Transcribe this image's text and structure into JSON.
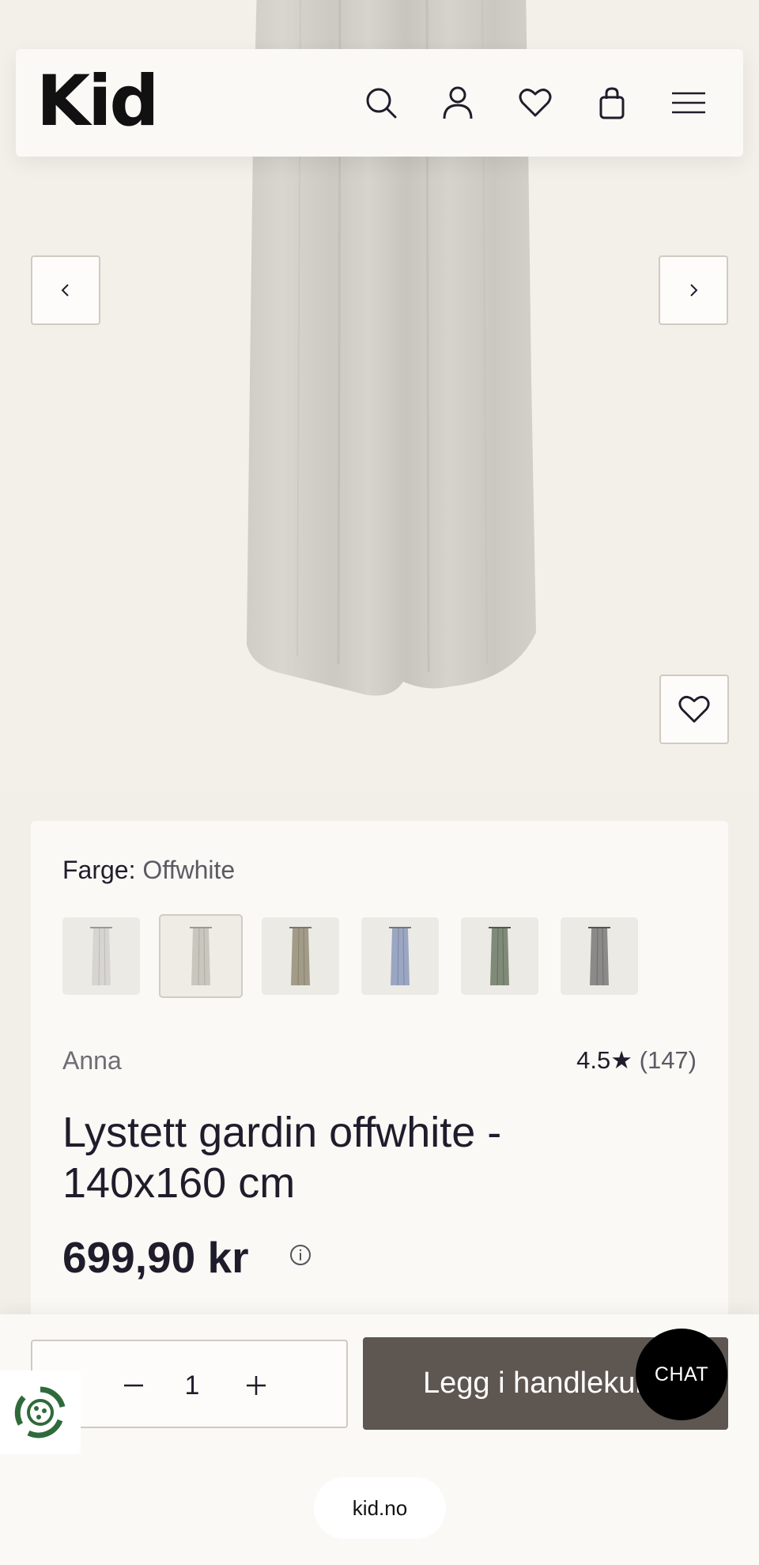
{
  "brand_logo": "Kid",
  "header": {
    "icons": [
      "search-icon",
      "account-icon",
      "heart-icon",
      "bag-icon",
      "menu-icon"
    ]
  },
  "gallery": {
    "prev_icon": "chevron-left-icon",
    "next_icon": "chevron-right-icon",
    "favorite_icon": "heart-icon"
  },
  "product": {
    "color_label": "Farge:",
    "color_value": "Offwhite",
    "swatches": [
      {
        "name": "white",
        "color": "#d7d5d1"
      },
      {
        "name": "offwhite",
        "color": "#c9c6bd"
      },
      {
        "name": "beige",
        "color": "#a29b87"
      },
      {
        "name": "blue",
        "color": "#9aa6c2"
      },
      {
        "name": "green",
        "color": "#7f8b78"
      },
      {
        "name": "grey",
        "color": "#8c8a88"
      }
    ],
    "brand": "Anna",
    "rating": "4.5",
    "rating_star": "★",
    "review_count": "(147)",
    "title": "Lystett gardin offwhite - 140x160 cm",
    "price": "699,90 kr"
  },
  "cart": {
    "quantity": "1",
    "add_label": "Legg i handlekurv",
    "chat_label": "CHAT"
  },
  "footer": {
    "url": "kid.no"
  },
  "colors": {
    "button_dark": "#5e5651",
    "background": "#f2efe9",
    "card": "#faf9f5"
  }
}
